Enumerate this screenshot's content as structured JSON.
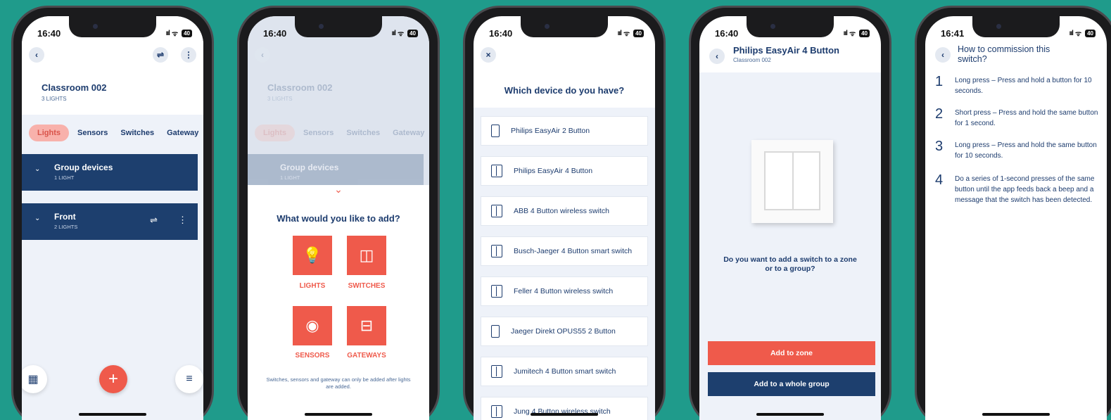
{
  "status_bar": {
    "time_main": "16:40",
    "time_last": "16:41",
    "signal": "ııl",
    "wifi": "ᯤ",
    "battery": "40"
  },
  "screen1": {
    "back": "‹",
    "filter": "⇌",
    "more": "⋮",
    "title": "Classroom 002",
    "subtitle": "3 LIGHTS",
    "tabs": [
      "Lights",
      "Sensors",
      "Switches",
      "Gateway"
    ],
    "groups": [
      {
        "title": "Group devices",
        "subtitle": "1 LIGHT",
        "chevron": "⌄"
      },
      {
        "title": "Front",
        "subtitle": "2 LIGHTS",
        "chevron": "⌄",
        "filter": "⇌",
        "more": "⋮"
      }
    ],
    "fab": "+",
    "left_btn": "▦",
    "right_btn": "≡"
  },
  "screen2": {
    "dim_title": "Classroom 002",
    "dim_subtitle": "3 LIGHTS",
    "dim_tabs": [
      "Lights",
      "Sensors",
      "Switches",
      "Gateway"
    ],
    "dim_group": "Group devices",
    "dim_group_sub": "1 LIGHT",
    "chevron": "⌄",
    "question": "What would you like to add?",
    "tiles": [
      {
        "label": "LIGHTS",
        "icon": "💡"
      },
      {
        "label": "SWITCHES",
        "icon": "◫"
      },
      {
        "label": "SENSORS",
        "icon": "◉"
      },
      {
        "label": "GATEWAYS",
        "icon": "⊟"
      }
    ],
    "note": "Switches, sensors and gateway can only be added after lights are added."
  },
  "screen3": {
    "close": "×",
    "question": "Which device do you have?",
    "devices": [
      {
        "name": "Philips EasyAir 2 Button",
        "type": "two"
      },
      {
        "name": "Philips EasyAir 4 Button",
        "type": "four"
      },
      {
        "name": "ABB 4 Button wireless switch",
        "type": "four"
      },
      {
        "name": "Busch-Jaeger 4 Button smart switch",
        "type": "four"
      },
      {
        "name": "Feller 4 Button wireless switch",
        "type": "four"
      },
      {
        "name": "Jaeger Direkt OPUS55 2 Button",
        "type": "two"
      },
      {
        "name": "Jumitech 4 Button smart switch",
        "type": "four"
      },
      {
        "name": "Jung 4 Button wireless switch",
        "type": "four"
      }
    ]
  },
  "screen4": {
    "back": "‹",
    "title": "Philips EasyAir 4 Button",
    "subtitle": "Classroom 002",
    "question": "Do you want to add a switch to a zone or to a group?",
    "btn_zone": "Add to zone",
    "btn_group": "Add to a whole group",
    "colors": {
      "zone": "#ef5a4b",
      "group": "#1d3f6e"
    }
  },
  "screen5": {
    "back": "‹",
    "title": "How to commission this switch?",
    "steps": [
      {
        "num": "1",
        "text": "Long press – Press and hold a button for 10 seconds."
      },
      {
        "num": "2",
        "text": "Short press – Press and hold the same button for 1 second."
      },
      {
        "num": "3",
        "text": "Long press – Press and hold the same button for 10 seconds."
      },
      {
        "num": "4",
        "text": "Do a series of 1-second presses of the same button until the app feeds back a beep and a message that the switch has been detected."
      }
    ]
  }
}
